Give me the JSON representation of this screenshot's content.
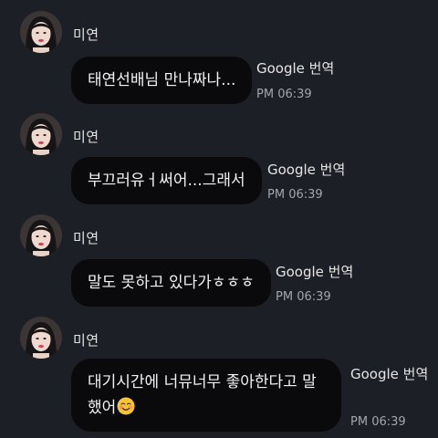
{
  "chat": {
    "messages": [
      {
        "sender": "미연",
        "text": "태연선배님 만나짜나...",
        "translate_label": "Google 번역",
        "time": "PM 06:39"
      },
      {
        "sender": "미연",
        "text": "부끄러유ㅓ써어...그래서",
        "translate_label": "Google 번역",
        "time": "PM 06:39"
      },
      {
        "sender": "미연",
        "text": "말도 못하고 있다가ㅎㅎㅎ",
        "translate_label": "Google 번역",
        "time": "PM 06:39"
      },
      {
        "sender": "미연",
        "text_line1": "대기시간에 너뮤너무 좋아한다고 말",
        "text_line2": "했어",
        "emoji": "smiling-blushing-face-emoji",
        "translate_label": "Google 번역",
        "time": "PM 06:39"
      }
    ]
  },
  "colors": {
    "background": "#1d1f27",
    "bubble": "#0a0a0c",
    "time_text": "#a4a6ab"
  }
}
